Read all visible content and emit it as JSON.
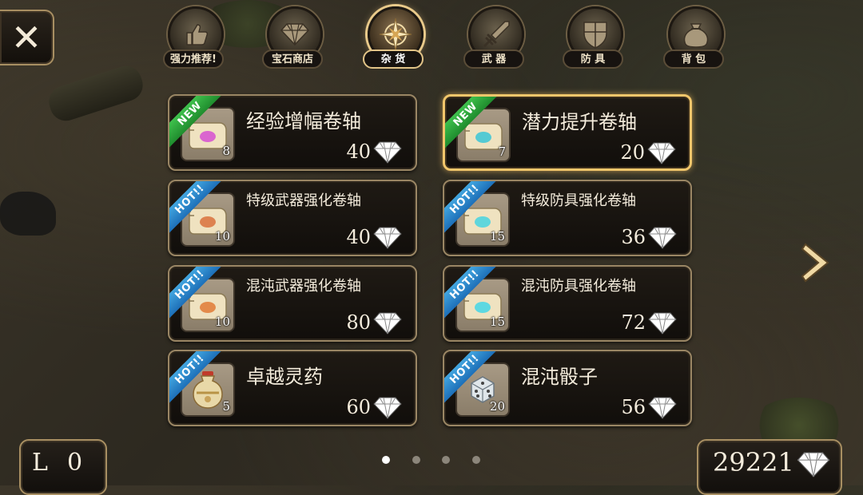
{
  "tabs": [
    {
      "label": "强力推荐!",
      "icon": "thumbs-up-icon"
    },
    {
      "label": "宝石商店",
      "icon": "gem-icon"
    },
    {
      "label": "杂 货",
      "icon": "compass-star-icon",
      "active": true
    },
    {
      "label": "武 器",
      "icon": "sword-icon"
    },
    {
      "label": "防 具",
      "icon": "shield-icon"
    },
    {
      "label": "背 包",
      "icon": "bag-icon"
    }
  ],
  "items": [
    {
      "name": "经验增幅卷轴",
      "qty": "8",
      "price": "40",
      "badge": "NEW",
      "scroll_color": "#d64fd1"
    },
    {
      "name": "潜力提升卷轴",
      "qty": "7",
      "price": "20",
      "badge": "NEW",
      "scroll_color": "#39c6d6"
    },
    {
      "name": "特级武器强化卷轴",
      "qty": "10",
      "price": "40",
      "badge": "HOT!!",
      "scroll_color": "#d9713c"
    },
    {
      "name": "特级防具强化卷轴",
      "qty": "15",
      "price": "36",
      "badge": "HOT!!",
      "scroll_color": "#45d4e0"
    },
    {
      "name": "混沌武器强化卷轴",
      "qty": "10",
      "price": "80",
      "badge": "HOT!!",
      "scroll_color": "#e07a35"
    },
    {
      "name": "混沌防具强化卷轴",
      "qty": "15",
      "price": "72",
      "badge": "HOT!!",
      "scroll_color": "#44d6e6"
    },
    {
      "name": "卓越灵药",
      "qty": "5",
      "price": "60",
      "badge": "HOT!!",
      "icon": "potion-jar-icon"
    },
    {
      "name": "混沌骰子",
      "qty": "20",
      "price": "56",
      "badge": "HOT!!",
      "icon": "dice-icon"
    }
  ],
  "selected_item": "潜力提升卷轴",
  "pagination": {
    "current": 1,
    "total": 4
  },
  "player": {
    "level_label": "L",
    "level_value": "0",
    "gems": "29221"
  },
  "colors": {
    "new_badge": "#2aa83a",
    "hot_badge": "#2a86cf",
    "selected_border": "#f2c66b",
    "card_border": "#9a8664"
  },
  "icons": {
    "close": "close-icon",
    "next": "chevron-right-icon",
    "currency": "diamond-icon"
  }
}
